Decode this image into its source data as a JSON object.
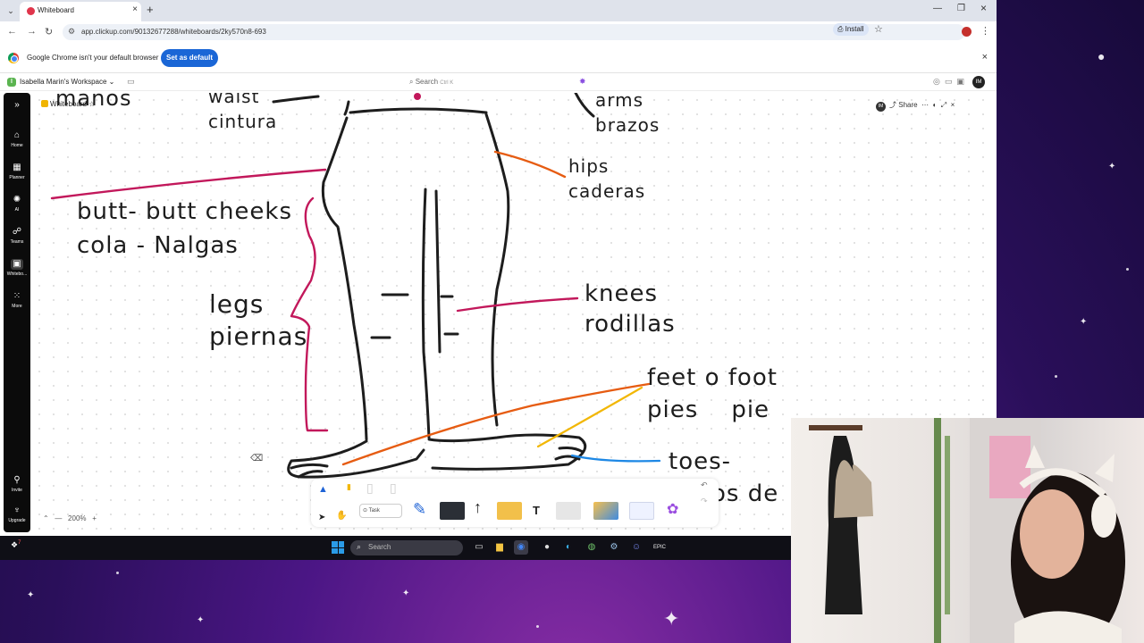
{
  "browser": {
    "tab_title": "Whiteboard",
    "url": "app.clickup.com/90132677288/whiteboards/2ky570n8-693",
    "install_label": "Install",
    "infobar_message": "Google Chrome isn't your default browser",
    "set_default_label": "Set as default"
  },
  "app": {
    "workspace_initial": "I",
    "workspace_name": "Isabella Marin's Workspace",
    "search_label": "Search",
    "search_shortcut": "Ctrl K",
    "avatar_initials": "IM"
  },
  "sidebar": {
    "items": [
      {
        "label": "Home",
        "icon": "home-icon"
      },
      {
        "label": "Planner",
        "icon": "calendar-icon"
      },
      {
        "label": "AI",
        "icon": "ai-icon"
      },
      {
        "label": "Teams",
        "icon": "teams-icon"
      },
      {
        "label": "Whitebo...",
        "icon": "whiteboard-icon"
      },
      {
        "label": "More",
        "icon": "grid-icon"
      },
      {
        "label": "Invite",
        "icon": "invite-icon"
      },
      {
        "label": "Upgrade",
        "icon": "upgrade-icon"
      }
    ]
  },
  "whiteboard": {
    "title": "Whiteboard",
    "share_label": "Share",
    "zoom": "200%",
    "labels": {
      "manos": "manos",
      "waist": "waist",
      "cintura": "cintura",
      "arms": "arms",
      "brazos": "brazos",
      "hips": "hips",
      "caderas": "caderas",
      "butt_line1": "butt- butt cheeks",
      "butt_line2": "cola - Nalgas",
      "legs": "legs",
      "piernas": "piernas",
      "knees": "knees",
      "rodillas": "rodillas",
      "feet_line1": "feet o foot",
      "feet_line2": "pies    pie",
      "toes_line1": "toes-",
      "toes_line2": "os de"
    },
    "ink_colors": {
      "magenta": "#c2185b",
      "orange": "#e65c12",
      "yellow": "#f2b705",
      "blue": "#1e88e5",
      "black": "#1d1d1d"
    },
    "tools": {
      "task_label": "Task",
      "text_tool": "T"
    }
  },
  "taskbar": {
    "search_placeholder": "Search",
    "notification_count": "7"
  }
}
